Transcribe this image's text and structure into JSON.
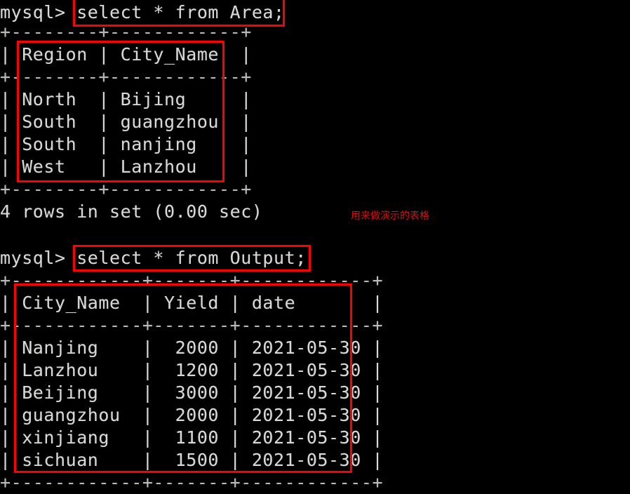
{
  "terminal": {
    "background_color": "#000000",
    "text_color": "#d8d8d8",
    "annotation_color": "#fe0000",
    "prompt": "mysql>"
  },
  "queries": {
    "first": "select * from Area;",
    "second": "select * from Output;"
  },
  "lines": {
    "l01": "mysql> select * from Area;",
    "l02": "+--------+------------+",
    "l03": "| Region | City_Name  |",
    "l04": "+--------+------------+",
    "l05": "| North  | Bijing     |",
    "l06": "| South  | guangzhou  |",
    "l07": "| South  | nanjing    |",
    "l08": "| West   | Lanzhou    |",
    "l09": "+--------+------------+",
    "l10": "4 rows in set (0.00 sec)",
    "l11": "mysql> select * from Output;",
    "l12": "+------------+-------+------------+",
    "l13": "| City_Name  | Yield | date       |",
    "l14": "+------------+-------+------------+",
    "l15": "| Nanjing    |  2000 | 2021-05-30 |",
    "l16": "| Lanzhou    |  1200 | 2021-05-30 |",
    "l17": "| Beijing    |  3000 | 2021-05-30 |",
    "l18": "| guangzhou  |  2000 | 2021-05-30 |",
    "l19": "| xinjiang   |  1100 | 2021-05-30 |",
    "l20": "| sichuan    |  1500 | 2021-05-30 |",
    "l21": "+------------+-------+------------+"
  },
  "area_table": {
    "name": "Area",
    "columns": [
      "Region",
      "City_Name"
    ],
    "rows": [
      [
        "North",
        "Bijing"
      ],
      [
        "South",
        "guangzhou"
      ],
      [
        "South",
        "nanjing"
      ],
      [
        "West",
        "Lanzhou"
      ]
    ],
    "status": "4 rows in set (0.00 sec)"
  },
  "output_table": {
    "name": "Output",
    "columns": [
      "City_Name",
      "Yield",
      "date"
    ],
    "rows": [
      [
        "Nanjing",
        "2000",
        "2021-05-30"
      ],
      [
        "Lanzhou",
        "1200",
        "2021-05-30"
      ],
      [
        "Beijing",
        "3000",
        "2021-05-30"
      ],
      [
        "guangzhou",
        "2000",
        "2021-05-30"
      ],
      [
        "xinjiang",
        "1100",
        "2021-05-30"
      ],
      [
        "sichuan",
        "1500",
        "2021-05-30"
      ]
    ]
  },
  "annotations": {
    "note_cn": "用来做演示的表格"
  }
}
